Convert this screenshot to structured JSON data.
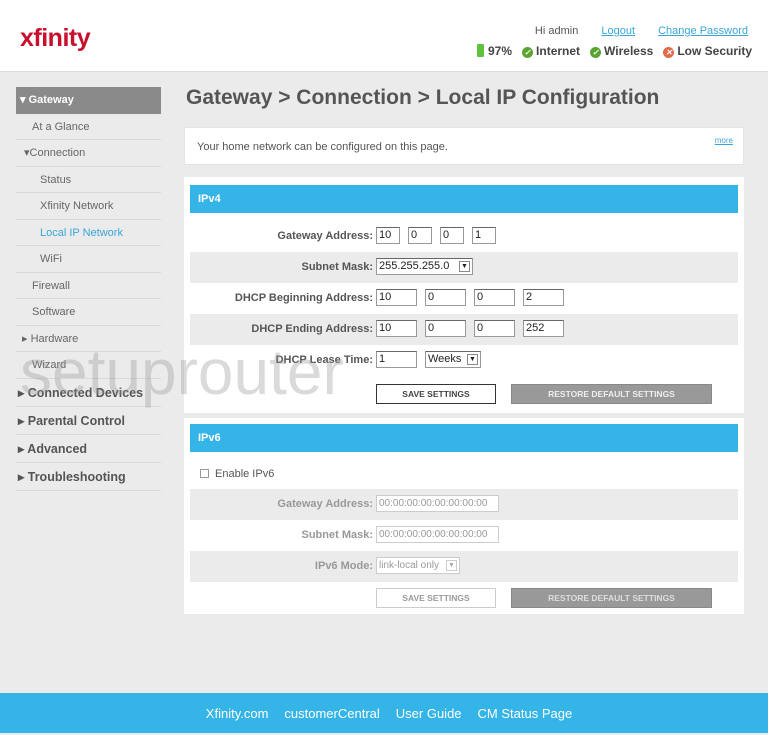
{
  "header": {
    "logo": "xfinity",
    "greeting": "Hi admin",
    "logout": "Logout",
    "change_password": "Change Password",
    "battery": "97%",
    "internet": "Internet",
    "wireless": "Wireless",
    "security": "Low Security"
  },
  "sidebar": {
    "gateway": "Gateway",
    "at_a_glance": "At a Glance",
    "connection": "Connection",
    "status": "Status",
    "xfinity_network": "Xfinity Network",
    "local_ip": "Local IP Network",
    "wifi": "WiFi",
    "firewall": "Firewall",
    "software": "Software",
    "hardware": "Hardware",
    "wizard": "Wizard",
    "connected_devices": "Connected Devices",
    "parental_control": "Parental Control",
    "advanced": "Advanced",
    "troubleshooting": "Troubleshooting"
  },
  "page": {
    "title": "Gateway > Connection > Local IP Configuration",
    "intro": "Your home network can be configured on this page.",
    "more": "more"
  },
  "ipv4": {
    "header": "IPv4",
    "gateway_label": "Gateway Address:",
    "gateway": [
      "10",
      "0",
      "0",
      "1"
    ],
    "subnet_label": "Subnet Mask:",
    "subnet": "255.255.255.0",
    "dhcp_begin_label": "DHCP Beginning Address:",
    "dhcp_begin": [
      "10",
      "0",
      "0",
      "2"
    ],
    "dhcp_end_label": "DHCP Ending Address:",
    "dhcp_end": [
      "10",
      "0",
      "0",
      "252"
    ],
    "lease_label": "DHCP Lease Time:",
    "lease": "1",
    "lease_unit": "Weeks",
    "save": "SAVE SETTINGS",
    "restore": "RESTORE DEFAULT SETTINGS"
  },
  "ipv6": {
    "header": "IPv6",
    "enable": "Enable IPv6",
    "gateway_label": "Gateway Address:",
    "gateway": "00:00:00:00:00:00:00:00",
    "subnet_label": "Subnet Mask:",
    "subnet": "00:00:00:00:00:00:00:00",
    "mode_label": "IPv6 Mode:",
    "mode": "link-local only",
    "save": "SAVE SETTINGS",
    "restore": "RESTORE DEFAULT SETTINGS"
  },
  "footer": {
    "links": [
      "Xfinity.com",
      "customerCentral",
      "User Guide",
      "CM Status Page"
    ]
  },
  "watermark": "setuprouter"
}
